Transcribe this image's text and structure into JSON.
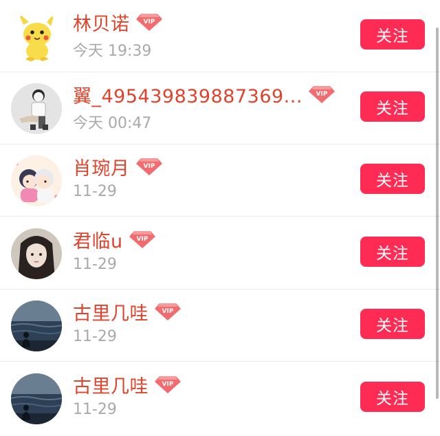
{
  "follow_label": "关注",
  "colors": {
    "name": "#e0432c",
    "button": "#fe2c55",
    "time": "#a9a9a9",
    "vip_badge": "#f26c6f"
  },
  "users": [
    {
      "name": "林贝诺",
      "time": "今天 19:39",
      "avatar": "pikachu-avatar"
    },
    {
      "name": "翼_495439839887369...",
      "time": "今天 00:47",
      "avatar": "sketch-person-avatar"
    },
    {
      "name": "肖琬月",
      "time": "11-29",
      "avatar": "anime-couple-avatar"
    },
    {
      "name": "君临u",
      "time": "11-29",
      "avatar": "anime-portrait-avatar"
    },
    {
      "name": "古里几哇",
      "time": "11-29",
      "avatar": "seaside-avatar"
    },
    {
      "name": "古里几哇",
      "time": "11-29",
      "avatar": "seaside-avatar"
    }
  ]
}
